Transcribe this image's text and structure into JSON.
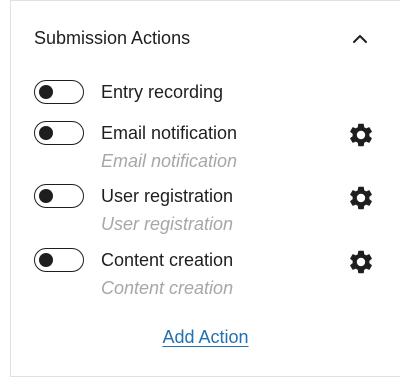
{
  "panel": {
    "title": "Submission Actions",
    "collapse_icon": "chevron-up-icon"
  },
  "actions": [
    {
      "label": "Entry recording",
      "sublabel": "",
      "enabled": false,
      "has_settings": false
    },
    {
      "label": "Email notification",
      "sublabel": "Email notification",
      "enabled": false,
      "has_settings": true
    },
    {
      "label": "User registration",
      "sublabel": "User registration",
      "enabled": false,
      "has_settings": true
    },
    {
      "label": "Content creation",
      "sublabel": "Content creation",
      "enabled": false,
      "has_settings": true
    }
  ],
  "add_action_label": "Add Action",
  "colors": {
    "text": "#1e1e1e",
    "muted": "#a7a7a7",
    "link": "#2271b1",
    "border": "#e0e0e0"
  },
  "icons": {
    "settings": "gear-icon"
  }
}
